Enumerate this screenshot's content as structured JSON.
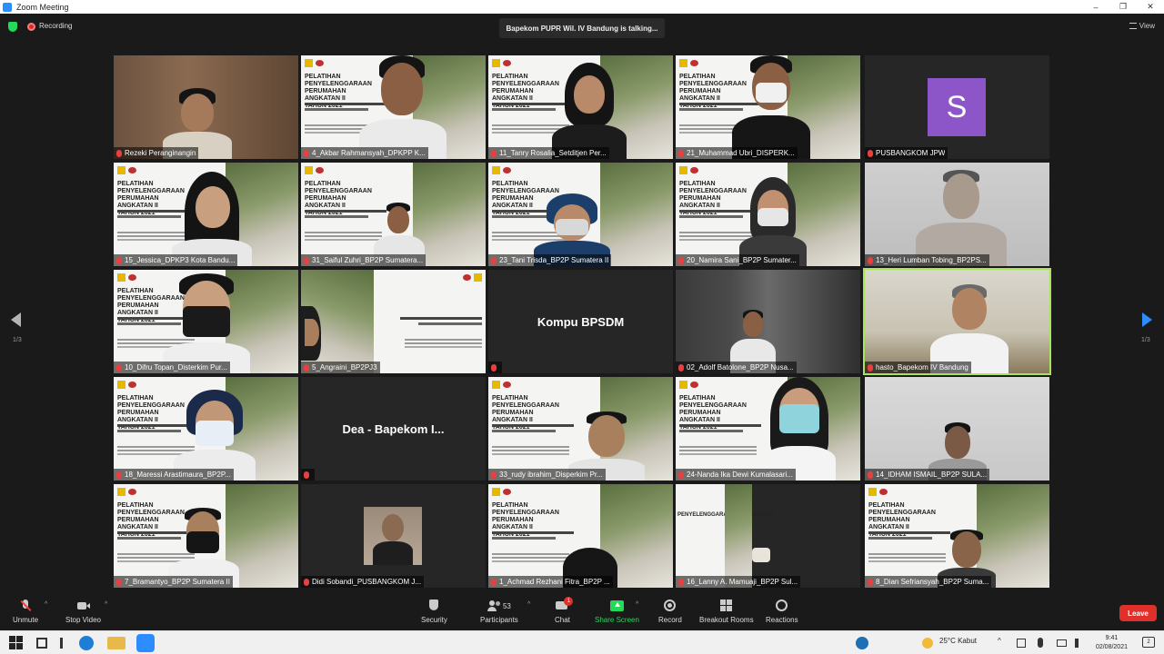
{
  "window": {
    "title": "Zoom Meeting",
    "minimize": "–",
    "maximize": "❐",
    "close": "✕"
  },
  "topbar": {
    "recording_label": "Recording",
    "talking_text": "Bapekom PUPR Wil. IV Bandung is talking...",
    "view_label": "View"
  },
  "slide_text": "PELATIHAN\nPENYELENGGARAAN PERUMAHAN\nANGKATAN II\nTAHUN 2021",
  "pagination": {
    "left": "1/3",
    "right": "1/3"
  },
  "participants": [
    {
      "name": "Rezeki Peranginangin"
    },
    {
      "name": "4_Akbar Rahmansyah_DPKPP K..."
    },
    {
      "name": "11_Tanry Rosalia_Setditjen Per..."
    },
    {
      "name": "21_Muhammad Ubri_DISPERK..."
    },
    {
      "name": "PUSBANGKOM JPW",
      "initial": "S"
    },
    {
      "name": "15_Jessica_DPKP3 Kota Bandu..."
    },
    {
      "name": "31_Saiful Zuhri_BP2P Sumatera..."
    },
    {
      "name": "23_Tani Trisda_BP2P Sumatera II"
    },
    {
      "name": "20_Namira Sani_BP2P Sumater..."
    },
    {
      "name": "13_Heri Lumban Tobing_BP2PS..."
    },
    {
      "name": "10_Difru Topan_Disterkim Pur..."
    },
    {
      "name": "5_Angraini_BP2PJ3"
    },
    {
      "name": "",
      "display": "Kompu BPSDM"
    },
    {
      "name": "02_Adolf Batolone_BP2P Nusa..."
    },
    {
      "name": "hasto_Bapekom IV Bandung"
    },
    {
      "name": "18_Maressi Arastimaura_BP2P..."
    },
    {
      "name": "",
      "display": "Dea - Bapekom I..."
    },
    {
      "name": "33_rudy ibrahim_Disperkim Pr..."
    },
    {
      "name": "24-Nanda Ika Dewi Kumalasari..."
    },
    {
      "name": "14_IDHAM ISMAIL_BP2P SULA..."
    },
    {
      "name": "7_Bramantyo_BP2P Sumatera II"
    },
    {
      "name": "Didi Sobandi_PUSBANGKOM J..."
    },
    {
      "name": "1_Achmad Rezhani Fitra_BP2P ..."
    },
    {
      "name": "16_Lanny A. Mamuaji_BP2P Sul..."
    },
    {
      "name": "8_Dian Sefriansyah_BP2P Suma..."
    }
  ],
  "toolbar": {
    "unmute": "Unmute",
    "stop_video": "Stop Video",
    "security": "Security",
    "participants": "Participants",
    "participants_count": "53",
    "chat": "Chat",
    "chat_badge": "1",
    "share_screen": "Share Screen",
    "record": "Record",
    "breakout_rooms": "Breakout Rooms",
    "reactions": "Reactions",
    "leave": "Leave"
  },
  "taskbar": {
    "weather": "25°C  Kabut",
    "time": "9:41",
    "date": "02/08/2021",
    "notifications": "2"
  },
  "colors": {
    "accent": "#2d8cff",
    "leave": "#e0302c",
    "share": "#23d959",
    "avatar": "#8c56c8"
  }
}
